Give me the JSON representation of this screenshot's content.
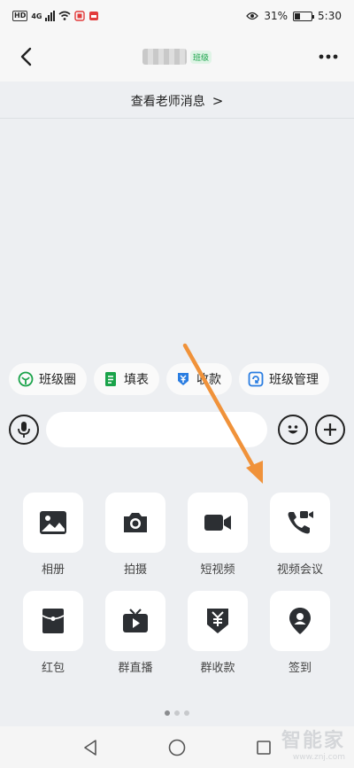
{
  "status_bar": {
    "hd": "HD",
    "network": "4G",
    "battery_percent": "31%",
    "time": "5:30",
    "battery_level": 0.31
  },
  "header": {
    "class_badge": "班级"
  },
  "teacher_banner": {
    "text": "查看老师消息",
    "chevron": ">"
  },
  "quick_actions": [
    {
      "label": "班级圈",
      "icon": "class-circle-icon",
      "color": "#1aa34a"
    },
    {
      "label": "填表",
      "icon": "form-icon",
      "color": "#1aa34a"
    },
    {
      "label": "收款",
      "icon": "payment-icon",
      "color": "#2a7de1"
    },
    {
      "label": "班级管理",
      "icon": "class-manage-icon",
      "color": "#2a7de1"
    }
  ],
  "input_bar": {
    "voice_icon": "microphone-icon",
    "emoji_icon": "emoji-icon",
    "add_icon": "plus-icon",
    "message_value": ""
  },
  "panel": {
    "items": [
      {
        "label": "相册",
        "icon": "image-icon"
      },
      {
        "label": "拍摄",
        "icon": "camera-icon"
      },
      {
        "label": "短视频",
        "icon": "video-camera-icon"
      },
      {
        "label": "视频会议",
        "icon": "video-call-icon"
      },
      {
        "label": "红包",
        "icon": "red-envelope-icon"
      },
      {
        "label": "群直播",
        "icon": "live-tv-icon"
      },
      {
        "label": "群收款",
        "icon": "yuan-collect-icon"
      },
      {
        "label": "签到",
        "icon": "location-pin-icon"
      }
    ],
    "page_count": 3,
    "active_page": 1
  },
  "watermark": {
    "title": "智能家",
    "url": "www.znj.com"
  },
  "colors": {
    "accent_green": "#1aa34a",
    "accent_blue": "#2a7de1",
    "arrow": "#f0923a",
    "icon_dark": "#2c2f33"
  }
}
